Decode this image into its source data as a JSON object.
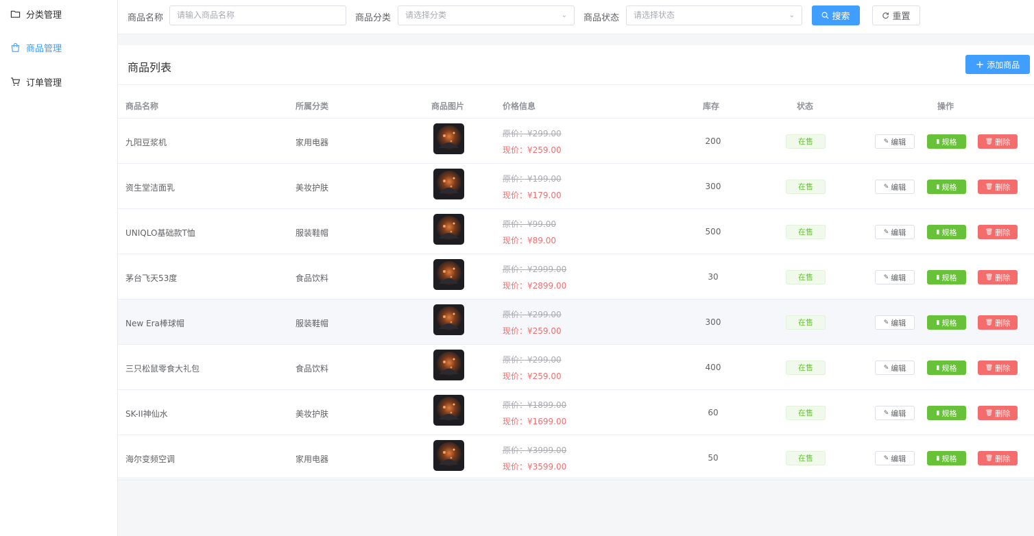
{
  "sidebar": {
    "items": [
      {
        "label": "分类管理",
        "icon": "folder-icon"
      },
      {
        "label": "商品管理",
        "icon": "shopping-bag-icon"
      },
      {
        "label": "订单管理",
        "icon": "cart-icon"
      }
    ]
  },
  "filter": {
    "name_label": "商品名称",
    "name_placeholder": "请输入商品名称",
    "category_label": "商品分类",
    "category_placeholder": "请选择分类",
    "status_label": "商品状态",
    "status_placeholder": "请选择状态",
    "search_label": "搜索",
    "reset_label": "重置"
  },
  "list": {
    "title": "商品列表",
    "add_label": "添加商品",
    "columns": [
      "商品名称",
      "所属分类",
      "商品图片",
      "价格信息",
      "库存",
      "状态",
      "操作"
    ],
    "orig_prefix": "原价：",
    "now_prefix": "现价：",
    "actions": {
      "edit": "编辑",
      "spec": "规格",
      "delete": "删除"
    },
    "rows": [
      {
        "name": "九阳豆浆机",
        "category": "家用电器",
        "orig": "¥299.00",
        "now": "¥259.00",
        "stock": "200",
        "status": "在售"
      },
      {
        "name": "资生堂洁面乳",
        "category": "美妆护肤",
        "orig": "¥199.00",
        "now": "¥179.00",
        "stock": "300",
        "status": "在售"
      },
      {
        "name": "UNIQLO基础款T恤",
        "category": "服装鞋帽",
        "orig": "¥99.00",
        "now": "¥89.00",
        "stock": "500",
        "status": "在售"
      },
      {
        "name": "茅台飞天53度",
        "category": "食品饮料",
        "orig": "¥2999.00",
        "now": "¥2899.00",
        "stock": "30",
        "status": "在售"
      },
      {
        "name": "New Era棒球帽",
        "category": "服装鞋帽",
        "orig": "¥299.00",
        "now": "¥259.00",
        "stock": "300",
        "status": "在售"
      },
      {
        "name": "三只松鼠零食大礼包",
        "category": "食品饮料",
        "orig": "¥299.00",
        "now": "¥259.00",
        "stock": "400",
        "status": "在售"
      },
      {
        "name": "SK-II神仙水",
        "category": "美妆护肤",
        "orig": "¥1899.00",
        "now": "¥1699.00",
        "stock": "60",
        "status": "在售"
      },
      {
        "name": "海尔变频空调",
        "category": "家用电器",
        "orig": "¥3999.00",
        "now": "¥3599.00",
        "stock": "50",
        "status": "在售"
      }
    ]
  },
  "colors": {
    "primary": "#409eff",
    "success": "#67c23a",
    "danger": "#f56c6c"
  }
}
